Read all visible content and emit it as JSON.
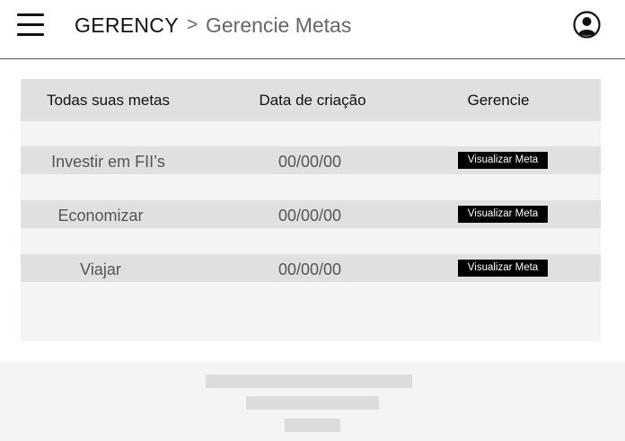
{
  "header": {
    "brand": "GERENCY",
    "separator": ">",
    "breadcrumb": "Gerencie Metas",
    "menu_icon": "hamburger-menu-icon",
    "user_icon": "user-circle-icon"
  },
  "table": {
    "columns": [
      "Todas suas metas",
      "Data de criação",
      "Gerencie"
    ],
    "rows": [
      {
        "name": "Investir em FII’s",
        "date": "00/00/00",
        "action": "Visualizar Meta"
      },
      {
        "name": "Economizar",
        "date": "00/00/00",
        "action": "Visualizar Meta"
      },
      {
        "name": "Viajar",
        "date": "00/00/00",
        "action": "Visualizar Meta"
      }
    ]
  },
  "colors": {
    "header_bg": "#ffffff",
    "panel_bg": "#f4f4f4",
    "row_bg": "#e0e0e0",
    "button_bg": "#000000",
    "button_text": "#ffffff",
    "placeholder": "#dcdcdc"
  }
}
